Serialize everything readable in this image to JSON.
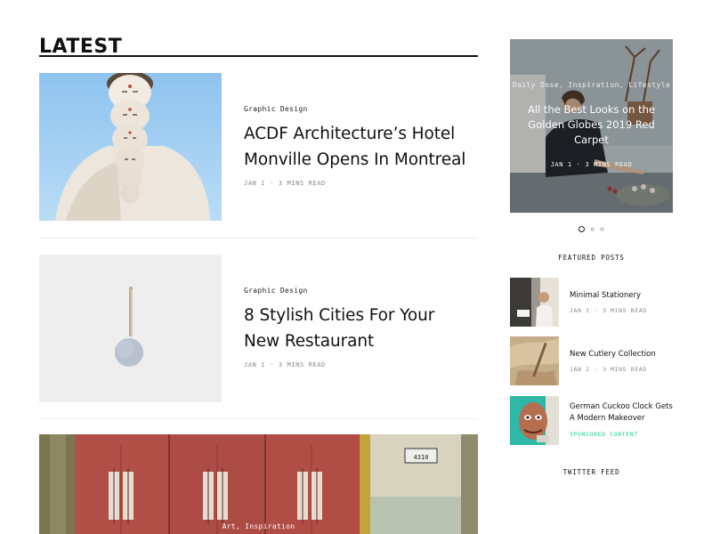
{
  "latest": {
    "heading": "LATEST",
    "posts": [
      {
        "category": "Graphic Design",
        "title": "ACDF Architecture’s Hotel Monville Opens In Montreal",
        "date": "JAN 1",
        "read_time": "3 MINS READ"
      },
      {
        "category": "Graphic Design",
        "title": "8 Stylish Cities For Your New Restaurant",
        "date": "JAN 1",
        "read_time": "3 MINS READ"
      }
    ],
    "big_post": {
      "category": "Art, Inspiration",
      "sign_text": "4310"
    }
  },
  "sidebar": {
    "slider": {
      "category": "Daily Dose, Inspiration, Lifestyle",
      "title": "All the Best Looks on the Golden Globes 2019 Red Carpet",
      "date": "JAN 1",
      "read_time": "3 MINS READ"
    },
    "featured_heading": "FEATURED POSTS",
    "featured": [
      {
        "title": "Minimal Stationery",
        "date": "JAN 2",
        "read_time": "3 MINS READ"
      },
      {
        "title": "New Cutlery Collection",
        "date": "JAN 2",
        "read_time": "3 MINS READ"
      },
      {
        "title": "German Cuckoo Clock Gets A Modern Makeover",
        "sponsored": "SPONSORED CONTENT"
      }
    ],
    "twitter_heading": "TWITTER FEED"
  },
  "colors": {
    "sponsored": "#2ecc8f",
    "text": "#111111",
    "meta": "#888888"
  },
  "icons": [
    "slider-dot-icon"
  ]
}
